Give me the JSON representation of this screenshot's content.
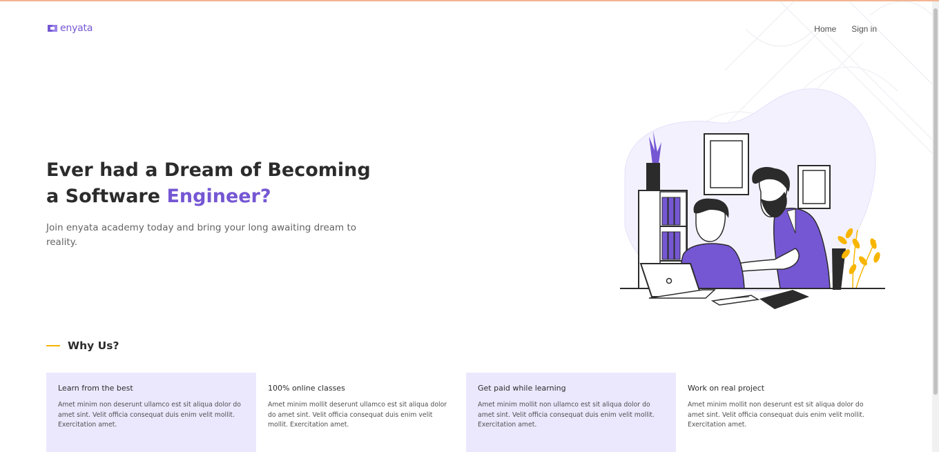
{
  "brand": {
    "name": "enyata",
    "color": "#7557d3"
  },
  "nav": {
    "home": "Home",
    "signin": "Sign in"
  },
  "hero": {
    "title_line1": "Ever had a Dream of Becoming",
    "title_line2_prefix": "a Software ",
    "title_line2_accent": "Engineer?",
    "subtitle": "Join enyata academy today and bring your long awaiting dream to reality."
  },
  "why": {
    "title": "Why Us?"
  },
  "cards": [
    {
      "title": "Learn from the best",
      "body": "Amet minim non deserunt ullamco est sit aliqua dolor do amet sint. Velit officia consequat duis enim velit mollit. Exercitation amet."
    },
    {
      "title": "100% online classes",
      "body": "Amet minim mollit deserunt ullamco est sit aliqua dolor do amet sint. Velit officia consequat duis enim velit mollit. Exercitation amet."
    },
    {
      "title": "Get paid while learning",
      "body": "Amet minim mollit non ullamco est sit aliqua dolor do amet sint. Velit officia consequat duis enim velit mollit. Exercitation amet."
    },
    {
      "title": "Work on real project",
      "body": "Amet minim mollit non deserunt est sit aliqua dolor do amet sint. Velit officia consequat duis enim velit mollit. Exercitation amet."
    }
  ],
  "colors": {
    "accent": "#7557d3",
    "highlight": "#f7b500",
    "card_tint": "#ebe8fe"
  },
  "icons": {
    "logo": "enyata-logo-icon",
    "illustration": "teacher-student-laptop-illustration"
  }
}
